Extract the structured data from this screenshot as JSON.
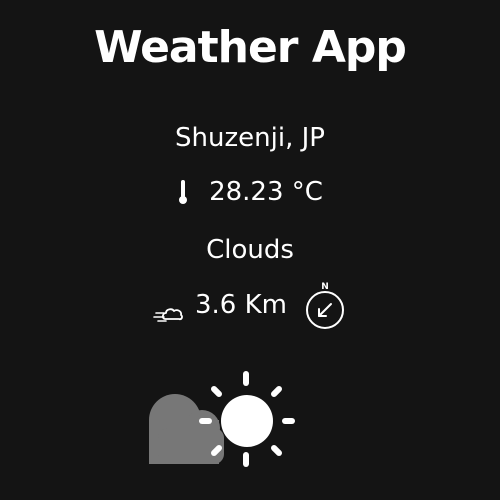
{
  "app": {
    "title": "Weather App"
  },
  "weather": {
    "location": "Shuzenji, JP",
    "temperature": "28.23 °C",
    "condition": "Clouds",
    "wind_speed": "3.6 Km"
  },
  "icons": {
    "temperature": "thermometer-icon",
    "wind": "wind-icon",
    "direction": "compass-icon",
    "condition": "partly-cloudy-sun-icon"
  },
  "colors": {
    "background": "#141414",
    "text": "#ffffff",
    "cloud": "#777777"
  }
}
